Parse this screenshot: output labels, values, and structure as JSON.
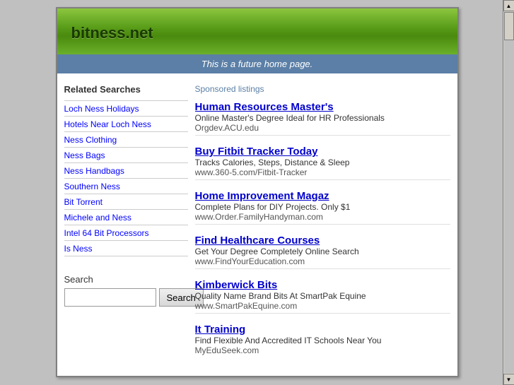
{
  "header": {
    "site_title": "bitness.net",
    "subtitle": "This is a future home page."
  },
  "left_col": {
    "related_heading": "Related Searches",
    "related_items": [
      {
        "label": "Loch Ness Holidays"
      },
      {
        "label": "Hotels Near Loch Ness"
      },
      {
        "label": "Ness Clothing"
      },
      {
        "label": "Ness Bags"
      },
      {
        "label": "Ness Handbags"
      },
      {
        "label": "Southern Ness"
      },
      {
        "label": "Bit Torrent"
      },
      {
        "label": "Michele and Ness"
      },
      {
        "label": "Intel 64 Bit Processors"
      },
      {
        "label": "Is Ness"
      }
    ],
    "search_label": "Search",
    "search_button_label": "Search"
  },
  "right_col": {
    "sponsored_label": "Sponsored listings",
    "listings": [
      {
        "title": "Human Resources Master's",
        "desc": "Online Master's Degree Ideal for HR Professionals",
        "url": "Orgdev.ACU.edu"
      },
      {
        "title": "Buy Fitbit Tracker Today",
        "desc": "Tracks Calories, Steps, Distance & Sleep",
        "url": "www.360-5.com/Fitbit-Tracker"
      },
      {
        "title": "Home Improvement Magaz",
        "desc": "Complete Plans for DIY Projects. Only $1",
        "url": "www.Order.FamilyHandyman.com"
      },
      {
        "title": "Find Healthcare Courses",
        "desc": "Get Your Degree Completely Online Search",
        "url": "www.FindYourEducation.com"
      },
      {
        "title": "Kimberwick Bits",
        "desc": "Quality Name Brand Bits At SmartPak Equine",
        "url": "www.SmartPakEquine.com"
      },
      {
        "title": "It Training",
        "desc": "Find Flexible And Accredited IT Schools Near You",
        "url": "MyEduSeek.com"
      }
    ]
  },
  "scrollbar": {
    "up_arrow": "▲",
    "down_arrow": "▼"
  }
}
